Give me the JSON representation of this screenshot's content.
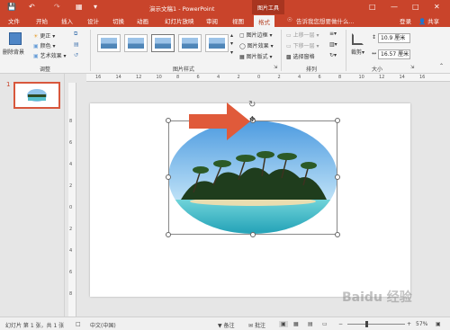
{
  "title_bar": {
    "document_title": "演示文稿1 - PowerPoint",
    "context_tab": "图片工具"
  },
  "tabs": [
    "文件",
    "开始",
    "插入",
    "设计",
    "切换",
    "动画",
    "幻灯片放映",
    "审阅",
    "视图",
    "格式"
  ],
  "active_tab": "格式",
  "tell_me": "告诉我您想要做什么...",
  "account": {
    "login": "登录",
    "share": "共享"
  },
  "ribbon": {
    "adjust": {
      "remove_bg": "删除背景",
      "corrections": "更正",
      "color": "颜色",
      "artistic": "艺术效果",
      "group_label": "调整"
    },
    "picture_styles": {
      "border": "图片边框",
      "effects": "图片效果",
      "layout": "图片版式",
      "group_label": "图片样式"
    },
    "arrange": {
      "bring_forward": "上移一层",
      "send_backward": "下移一层",
      "selection_pane": "选择窗格",
      "group_label": "排列"
    },
    "size": {
      "crop": "裁剪",
      "height": "10.9 厘米",
      "width": "16.57 厘米",
      "group_label": "大小"
    }
  },
  "slide_thumbnail": {
    "number": "1"
  },
  "ruler_h_ticks": [
    "16",
    "14",
    "12",
    "10",
    "8",
    "6",
    "4",
    "2",
    "0",
    "2",
    "4",
    "6",
    "8",
    "10",
    "12",
    "14",
    "16"
  ],
  "ruler_v_ticks": [
    "8",
    "6",
    "4",
    "2",
    "0",
    "2",
    "4",
    "6",
    "8"
  ],
  "status_bar": {
    "slide_count": "幻灯片 第 1 张，共 1 张",
    "language": "中文(中国)",
    "notes": "备注",
    "comments": "批注",
    "zoom": "57%"
  },
  "watermark": "Baidu 经验",
  "colors": {
    "accent": "#c9442b",
    "arrow": "#e05a3a"
  }
}
